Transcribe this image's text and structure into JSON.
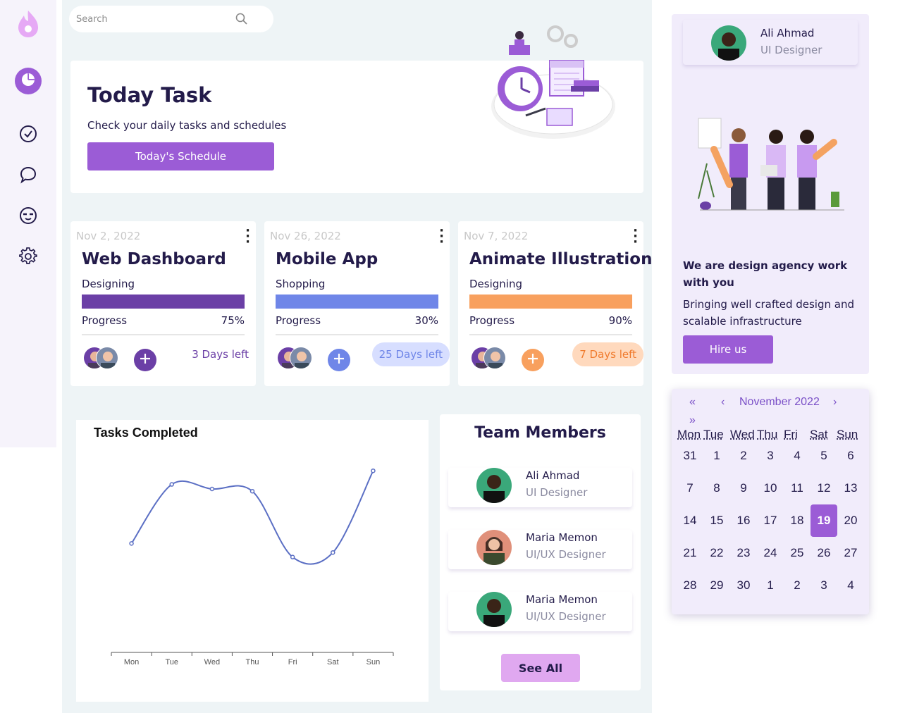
{
  "search": {
    "placeholder": "Search"
  },
  "today": {
    "title": "Today Task",
    "subtitle": "Check your daily tasks and schedules",
    "button": "Today's Schedule"
  },
  "projects": [
    {
      "date": "Nov 2, 2022",
      "title": "Web Dashboard",
      "category": "Designing",
      "progress_label": "Progress",
      "progress_text": "75%",
      "progress": 1.0,
      "days_left": "3 Days left",
      "color": "#6b3fa6",
      "add_color": "#6b3fa6",
      "days_bg": "#ffffff",
      "days_color": "#6b3fa6"
    },
    {
      "date": "Nov 26, 2022",
      "title": "Mobile App",
      "category": "Shopping",
      "progress_label": "Progress",
      "progress_text": "30%",
      "progress": 1.0,
      "days_left": "25 Days left",
      "color": "#6f86e8",
      "add_color": "#6f86e8",
      "days_bg": "#d7deff",
      "days_color": "#6f86e8"
    },
    {
      "date": "Nov 7, 2022",
      "title": "Animate Illustration",
      "category": "Designing",
      "progress_label": "Progress",
      "progress_text": "90%",
      "progress": 1.0,
      "days_left": "7 Days left",
      "color": "#f8a05e",
      "add_color": "#f8a05e",
      "days_bg": "#ffd9bd",
      "days_color": "#f07a2c"
    }
  ],
  "chart_data": {
    "type": "line",
    "title": "Tasks Completed",
    "categories": [
      "Mon",
      "Tue",
      "Wed",
      "Thu",
      "Fri",
      "Sat",
      "Sun"
    ],
    "series": [
      {
        "values": [
          2.4,
          3.7,
          3.6,
          3.55,
          2.1,
          2.2,
          4.0
        ]
      }
    ],
    "ylim": [
      0,
      4.5
    ],
    "color": "#5b6fc4"
  },
  "team": {
    "title": "Team Members",
    "members": [
      {
        "name": "Ali Ahmad",
        "role": "UI Designer"
      },
      {
        "name": "Maria Memon",
        "role": "UI/UX Designer"
      },
      {
        "name": "Maria Memon",
        "role": "UI/UX Designer"
      }
    ],
    "see_all": "See All"
  },
  "profile": {
    "name": "Ali Ahmad",
    "role": "UI Designer"
  },
  "agency": {
    "heading": "We are design agency work with you",
    "description": "Bringing well crafted design and scalable infrastructure",
    "button": "Hire us"
  },
  "calendar": {
    "prev_year": "«",
    "prev_month": "‹",
    "month_label": "November 2022",
    "next_month": "›",
    "next_year": "»",
    "weekdays": [
      "Mon",
      "Tue",
      "Wed",
      "Thu",
      "Fri",
      "Sat",
      "Sun"
    ],
    "weeks": [
      [
        "31",
        "1",
        "2",
        "3",
        "4",
        "5",
        "6"
      ],
      [
        "7",
        "8",
        "9",
        "10",
        "11",
        "12",
        "13"
      ],
      [
        "14",
        "15",
        "16",
        "17",
        "18",
        "19",
        "20"
      ],
      [
        "21",
        "22",
        "23",
        "24",
        "25",
        "26",
        "27"
      ],
      [
        "28",
        "29",
        "30",
        "1",
        "2",
        "3",
        "4"
      ]
    ],
    "selected": "19"
  },
  "colors": {
    "accent": "#9b5cd6",
    "dark": "#231b4a"
  },
  "icons": {
    "sidebar": [
      "flame-logo-icon",
      "pie-chart-icon",
      "check-circle-icon",
      "chat-bubble-icon",
      "emoji-face-icon",
      "gear-icon"
    ]
  }
}
